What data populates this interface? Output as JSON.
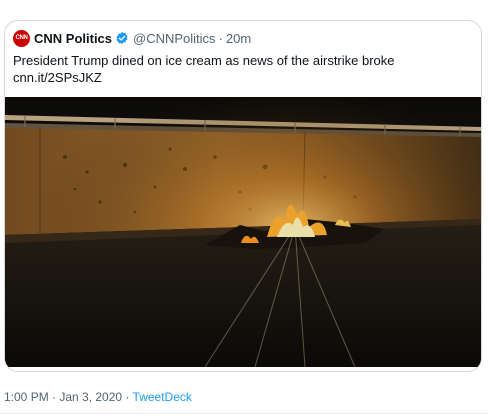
{
  "tweet": {
    "logo_text": "CNN",
    "author_name": "CNN Politics",
    "handle": "@CNNPolitics",
    "separator": "·",
    "age": "20m",
    "text_line1": "President Trump dined on ice cream as news of the airstrike broke",
    "text_line2": "cnn.it/2SPsJKZ",
    "posted_at": "1:00 PM · Jan 3, 2020 · ",
    "source": "TweetDeck"
  },
  "colors": {
    "brand_red": "#cc0000",
    "verified_blue": "#1d9bf0",
    "link_blue": "#1d9bf0",
    "muted_text": "#536471"
  },
  "icons": {
    "verified": "verified-badge-icon",
    "logo": "cnn-logo-icon"
  }
}
